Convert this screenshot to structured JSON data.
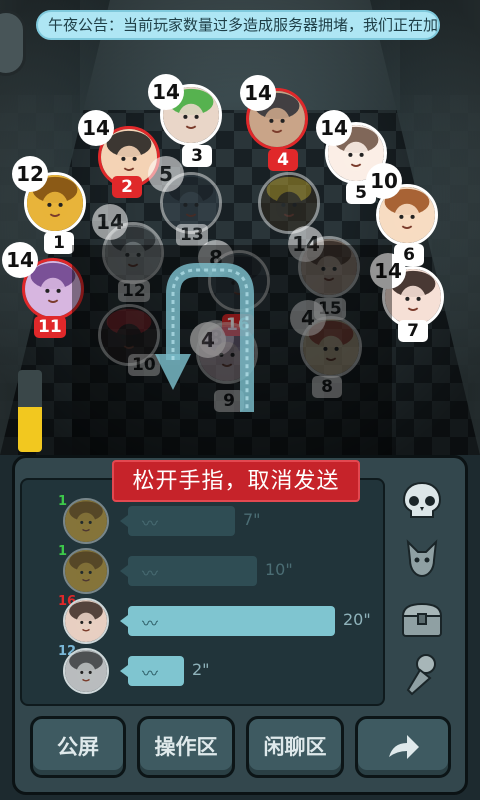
{
  "notice": {
    "text": "午夜公告：当前玩家数量过多造成服务器拥堵，我们正在加"
  },
  "players": [
    {
      "badge": "14",
      "seat": "2",
      "seat_style": "red",
      "style": "red",
      "face": "boy-cartoon"
    },
    {
      "badge": "14",
      "seat": "3",
      "seat_style": "white",
      "style": "white",
      "face": "girl-green"
    },
    {
      "badge": "14",
      "seat": "4",
      "seat_style": "red",
      "style": "red",
      "face": "man-photo"
    },
    {
      "badge": "14",
      "seat": "5",
      "seat_style": "white",
      "style": "white",
      "face": "glasses-cartoon"
    },
    {
      "badge": "12",
      "seat": "1",
      "seat_style": "white",
      "style": "white",
      "face": "coins"
    },
    {
      "badge": "10",
      "seat": "6",
      "seat_style": "white",
      "style": "white",
      "face": "brown-hair-cartoon"
    },
    {
      "badge": "14",
      "seat": "11",
      "seat_style": "red",
      "style": "red",
      "face": "swirl-cartoon"
    },
    {
      "badge": "14",
      "seat": "7",
      "seat_style": "white",
      "style": "white",
      "face": "girl-bob"
    },
    {
      "badge": "5",
      "seat": "13",
      "seat_style": "dim",
      "style": "dim",
      "face": "dark"
    },
    {
      "badge": "14",
      "seat": "12",
      "seat_style": "dim",
      "style": "dim",
      "face": "man-bw"
    },
    {
      "badge": "8",
      "seat": "",
      "seat_style": "dim",
      "style": "dim",
      "face": "star"
    },
    {
      "badge": "14",
      "seat": "15",
      "seat_style": "dim",
      "style": "dim",
      "face": "girl-long"
    },
    {
      "badge": "8",
      "seat": "16",
      "seat_style": "red",
      "style": "dim",
      "face": "dark"
    },
    {
      "badge": "4",
      "seat": "10",
      "seat_style": "dim",
      "style": "dim",
      "face": "heart"
    },
    {
      "badge": "4",
      "seat": "9",
      "seat_style": "dim",
      "style": "dim",
      "face": "anime-girl"
    },
    {
      "badge": "4",
      "seat": "8",
      "seat_style": "dim",
      "style": "dim",
      "face": "clown-cartoon"
    }
  ],
  "battery": {
    "level": 0.55,
    "color": "#f2c81f"
  },
  "cancel_banner": "松开手指，取消发送",
  "messages": [
    {
      "level": "1",
      "level_color": "#3cc84a",
      "duration": "7\"",
      "dim": true,
      "progress": 0.38,
      "avatar": "coins"
    },
    {
      "level": "1",
      "level_color": "#3cc84a",
      "duration": "10\"",
      "dim": true,
      "progress": 0.48,
      "avatar": "coins"
    },
    {
      "level": "16",
      "level_color": "#e0282a",
      "duration": "20\"",
      "dim": false,
      "progress": 0.82,
      "avatar": "girl-photo"
    },
    {
      "level": "12",
      "level_color": "#7ab8d8",
      "duration": "2\"",
      "dim": false,
      "progress": 0.16,
      "avatar": "man-bw"
    }
  ],
  "side_icons": [
    "skull-icon",
    "cat-icon",
    "chest-icon",
    "microphone-icon"
  ],
  "buttons": [
    {
      "label": "公屏"
    },
    {
      "label": "操作区"
    },
    {
      "label": "闲聊区"
    },
    {
      "label": "",
      "icon": "arrow-right-icon"
    }
  ]
}
